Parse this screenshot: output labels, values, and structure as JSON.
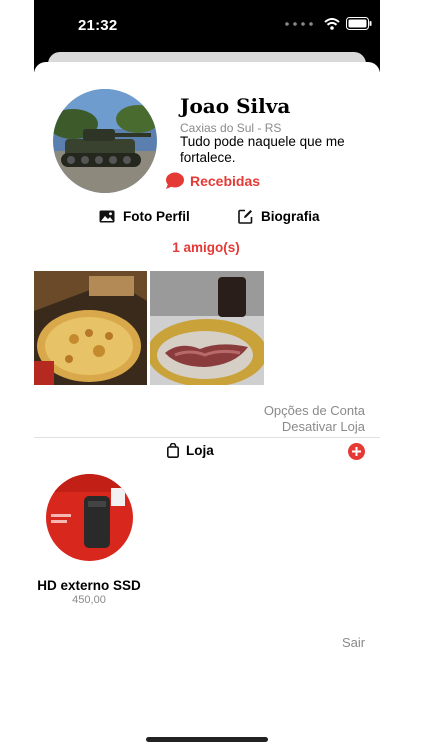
{
  "status_bar": {
    "time": "21:32"
  },
  "profile": {
    "name": "Joao Silva",
    "city": "Caxias do Sul - RS",
    "bio": "Tudo pode naquele que me fortalece.",
    "received_label": "Recebidas",
    "profile_photo_label": "Foto Perfil",
    "biography_label": "Biografia",
    "friends_label": "1 amigo(s)"
  },
  "options": {
    "account_options": "Opções de Conta",
    "deactivate_store": "Desativar Loja"
  },
  "store": {
    "tab_label": "Loja",
    "products": [
      {
        "name": "HD externo SSD",
        "price": "450,00"
      }
    ]
  },
  "logout_label": "Sair",
  "colors": {
    "accent": "#e53935",
    "muted": "#8a8a8a"
  }
}
